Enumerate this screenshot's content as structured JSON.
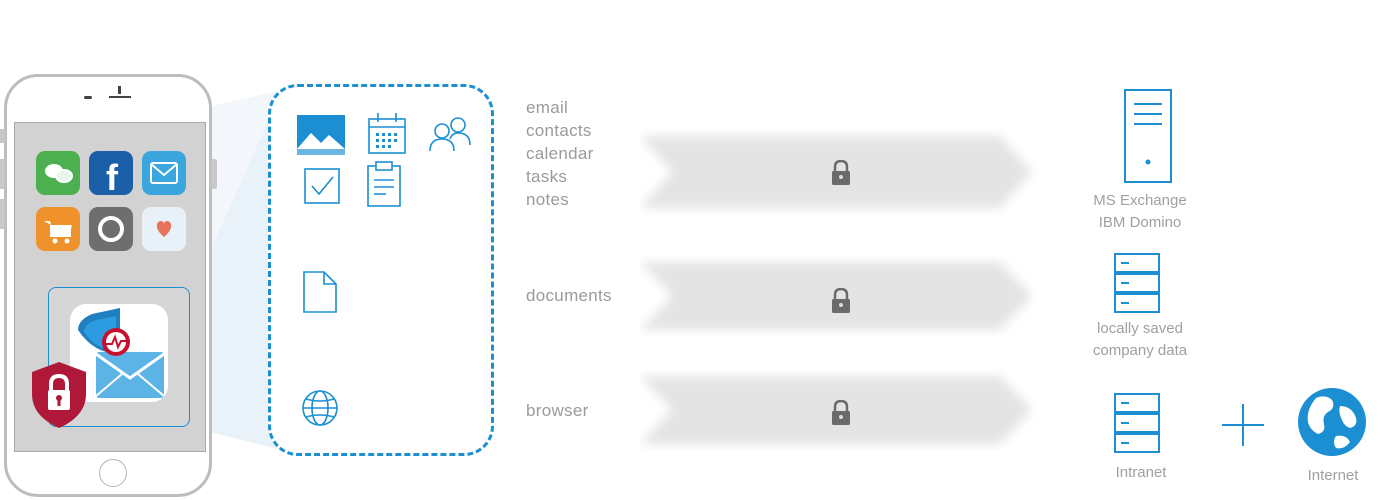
{
  "device": {
    "apps": [
      {
        "icon": "chat-icon",
        "color": "#4caf50"
      },
      {
        "icon": "facebook-icon",
        "color": "#1b5fa8",
        "glyph": "f"
      },
      {
        "icon": "mail-icon",
        "color": "#3aa6dd"
      },
      {
        "icon": "cart-icon",
        "color": "#f0922b"
      },
      {
        "icon": "circle-icon",
        "color": "#6e6e6e"
      },
      {
        "icon": "heart-icon",
        "color": "#e8f1f8"
      }
    ],
    "secure_app": {
      "icon": "secure-mail-icon",
      "badge": "padlock-shield-icon",
      "badge_color": "#b0183a"
    }
  },
  "container": {
    "icons": [
      "image-icon",
      "calendar-icon",
      "contacts-icon",
      "tasks-icon",
      "notes-icon",
      "document-icon",
      "globe-icon"
    ],
    "accent": "#1b8fd2"
  },
  "rows": [
    {
      "labels": [
        "email",
        "contacts",
        "calendar",
        "tasks",
        "notes"
      ],
      "lock": "lock-icon"
    },
    {
      "labels": [
        "documents"
      ],
      "lock": "lock-icon"
    },
    {
      "labels": [
        "browser"
      ],
      "lock": "lock-icon"
    }
  ],
  "targets": {
    "exchange": {
      "line1": "MS Exchange",
      "line2": "IBM Domino",
      "icon": "server-icon"
    },
    "local": {
      "line1": "locally saved",
      "line2": "company data",
      "icon": "server-rack-icon"
    },
    "intranet": {
      "label": "Intranet",
      "icon": "server-rack-icon"
    },
    "plus": "+",
    "internet": {
      "label": "Internet",
      "icon": "earth-globe-icon"
    }
  }
}
